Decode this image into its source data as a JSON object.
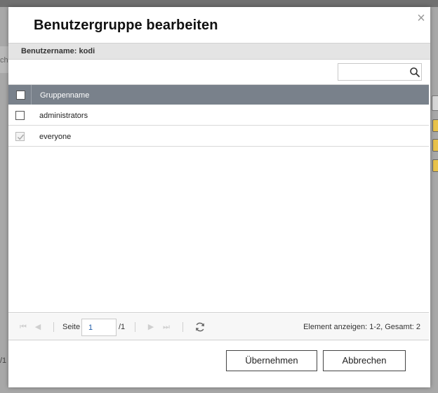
{
  "background": {
    "cut_text_left": "che",
    "cut_text_bottom": "/1"
  },
  "dialog": {
    "title": "Benutzergruppe bearbeiten",
    "close_glyph": "×",
    "username_label": "Benutzername: kodi",
    "search": {
      "placeholder": "",
      "value": ""
    },
    "table": {
      "column_header": "Gruppenname",
      "rows": [
        {
          "name": "administrators",
          "checked": false,
          "disabled": false
        },
        {
          "name": "everyone",
          "checked": true,
          "disabled": true
        }
      ]
    },
    "pager": {
      "page_label": "Seite",
      "current_page": "1",
      "total_pages": "/1",
      "summary": "Element anzeigen: 1-2, Gesamt: 2"
    },
    "buttons": {
      "apply": "Übernehmen",
      "cancel": "Abbrechen"
    }
  },
  "colors": {
    "header_bg": "#79818b",
    "page_input_text": "#1e5aa8"
  }
}
